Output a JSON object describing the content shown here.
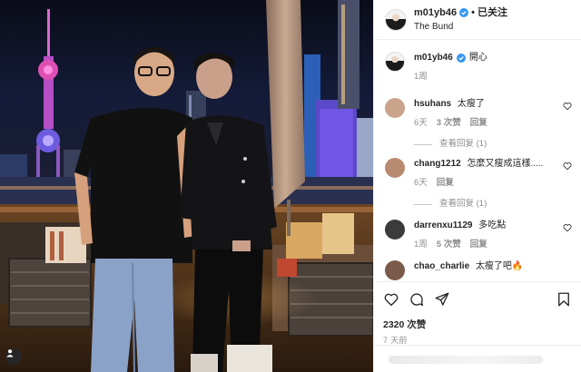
{
  "header": {
    "username": "m01yb46",
    "follow_state": "已关注",
    "location": "The Bund"
  },
  "caption": {
    "username": "m01yb46",
    "text": "開心",
    "age": "1周"
  },
  "comments": [
    {
      "username": "hsuhans",
      "text": "太瘦了",
      "age": "6天",
      "likes": "3 次赞",
      "reply": "回复",
      "view_replies": "查看回复 (1)",
      "avatar_color": "#c9a48a"
    },
    {
      "username": "chang1212",
      "text": "怎麼又瘦成這樣.....",
      "age": "6天",
      "likes": "",
      "reply": "回复",
      "view_replies": "查看回复 (1)",
      "avatar_color": "#b88a70"
    },
    {
      "username": "darrenxu1129",
      "text": "多吃點",
      "age": "1周",
      "likes": "5 次赞",
      "reply": "回复",
      "view_replies": "",
      "avatar_color": "#3b3b3b"
    },
    {
      "username": "chao_charlie",
      "text": "太瘦了吧🔥",
      "age": "",
      "likes": "",
      "reply": "",
      "view_replies": "",
      "avatar_color": "#7a5a48"
    }
  ],
  "footer": {
    "likes": "2320 次赞",
    "time": "7 天前"
  },
  "colors": {
    "verified": "#3897f0",
    "muted": "#8e8e8e",
    "text": "#262626"
  },
  "icons": [
    "verified-badge-icon",
    "heart-icon",
    "comment-icon",
    "share-icon",
    "bookmark-icon",
    "user-tag-icon"
  ]
}
